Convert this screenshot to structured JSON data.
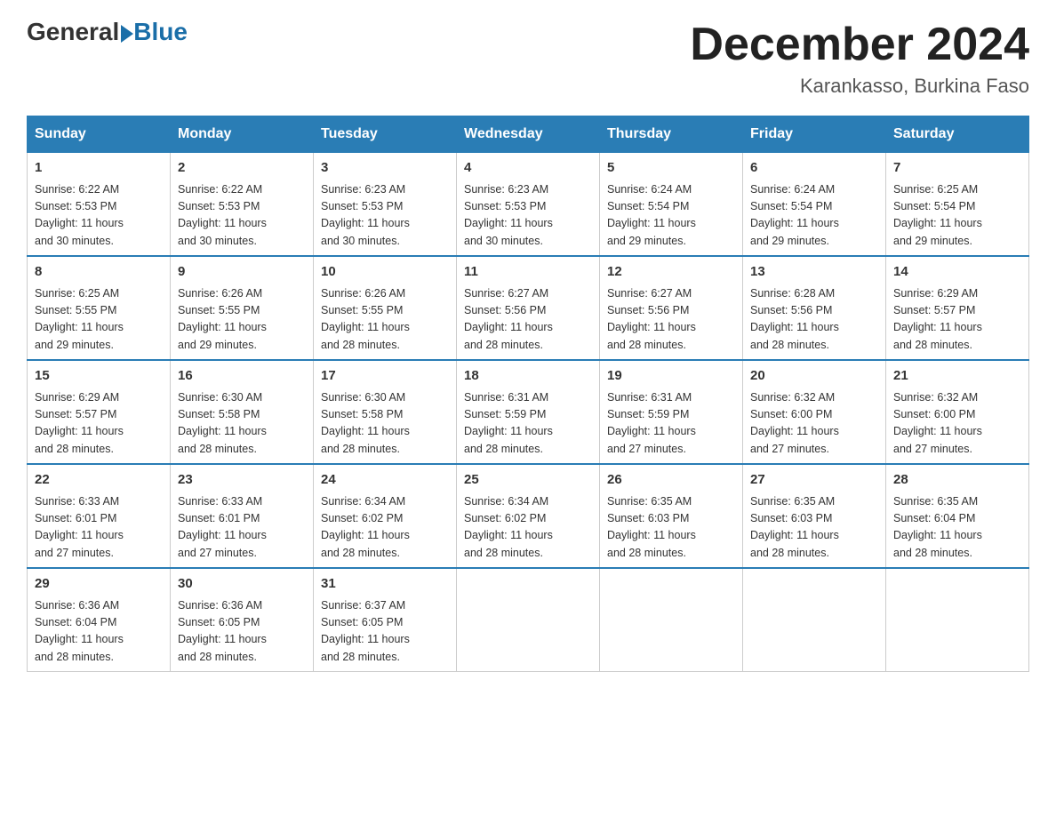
{
  "logo": {
    "general": "General",
    "blue": "Blue"
  },
  "header": {
    "month": "December 2024",
    "location": "Karankasso, Burkina Faso"
  },
  "weekdays": [
    "Sunday",
    "Monday",
    "Tuesday",
    "Wednesday",
    "Thursday",
    "Friday",
    "Saturday"
  ],
  "weeks": [
    [
      {
        "day": "1",
        "sunrise": "6:22 AM",
        "sunset": "5:53 PM",
        "daylight": "11 hours and 30 minutes."
      },
      {
        "day": "2",
        "sunrise": "6:22 AM",
        "sunset": "5:53 PM",
        "daylight": "11 hours and 30 minutes."
      },
      {
        "day": "3",
        "sunrise": "6:23 AM",
        "sunset": "5:53 PM",
        "daylight": "11 hours and 30 minutes."
      },
      {
        "day": "4",
        "sunrise": "6:23 AM",
        "sunset": "5:53 PM",
        "daylight": "11 hours and 30 minutes."
      },
      {
        "day": "5",
        "sunrise": "6:24 AM",
        "sunset": "5:54 PM",
        "daylight": "11 hours and 29 minutes."
      },
      {
        "day": "6",
        "sunrise": "6:24 AM",
        "sunset": "5:54 PM",
        "daylight": "11 hours and 29 minutes."
      },
      {
        "day": "7",
        "sunrise": "6:25 AM",
        "sunset": "5:54 PM",
        "daylight": "11 hours and 29 minutes."
      }
    ],
    [
      {
        "day": "8",
        "sunrise": "6:25 AM",
        "sunset": "5:55 PM",
        "daylight": "11 hours and 29 minutes."
      },
      {
        "day": "9",
        "sunrise": "6:26 AM",
        "sunset": "5:55 PM",
        "daylight": "11 hours and 29 minutes."
      },
      {
        "day": "10",
        "sunrise": "6:26 AM",
        "sunset": "5:55 PM",
        "daylight": "11 hours and 28 minutes."
      },
      {
        "day": "11",
        "sunrise": "6:27 AM",
        "sunset": "5:56 PM",
        "daylight": "11 hours and 28 minutes."
      },
      {
        "day": "12",
        "sunrise": "6:27 AM",
        "sunset": "5:56 PM",
        "daylight": "11 hours and 28 minutes."
      },
      {
        "day": "13",
        "sunrise": "6:28 AM",
        "sunset": "5:56 PM",
        "daylight": "11 hours and 28 minutes."
      },
      {
        "day": "14",
        "sunrise": "6:29 AM",
        "sunset": "5:57 PM",
        "daylight": "11 hours and 28 minutes."
      }
    ],
    [
      {
        "day": "15",
        "sunrise": "6:29 AM",
        "sunset": "5:57 PM",
        "daylight": "11 hours and 28 minutes."
      },
      {
        "day": "16",
        "sunrise": "6:30 AM",
        "sunset": "5:58 PM",
        "daylight": "11 hours and 28 minutes."
      },
      {
        "day": "17",
        "sunrise": "6:30 AM",
        "sunset": "5:58 PM",
        "daylight": "11 hours and 28 minutes."
      },
      {
        "day": "18",
        "sunrise": "6:31 AM",
        "sunset": "5:59 PM",
        "daylight": "11 hours and 28 minutes."
      },
      {
        "day": "19",
        "sunrise": "6:31 AM",
        "sunset": "5:59 PM",
        "daylight": "11 hours and 27 minutes."
      },
      {
        "day": "20",
        "sunrise": "6:32 AM",
        "sunset": "6:00 PM",
        "daylight": "11 hours and 27 minutes."
      },
      {
        "day": "21",
        "sunrise": "6:32 AM",
        "sunset": "6:00 PM",
        "daylight": "11 hours and 27 minutes."
      }
    ],
    [
      {
        "day": "22",
        "sunrise": "6:33 AM",
        "sunset": "6:01 PM",
        "daylight": "11 hours and 27 minutes."
      },
      {
        "day": "23",
        "sunrise": "6:33 AM",
        "sunset": "6:01 PM",
        "daylight": "11 hours and 27 minutes."
      },
      {
        "day": "24",
        "sunrise": "6:34 AM",
        "sunset": "6:02 PM",
        "daylight": "11 hours and 28 minutes."
      },
      {
        "day": "25",
        "sunrise": "6:34 AM",
        "sunset": "6:02 PM",
        "daylight": "11 hours and 28 minutes."
      },
      {
        "day": "26",
        "sunrise": "6:35 AM",
        "sunset": "6:03 PM",
        "daylight": "11 hours and 28 minutes."
      },
      {
        "day": "27",
        "sunrise": "6:35 AM",
        "sunset": "6:03 PM",
        "daylight": "11 hours and 28 minutes."
      },
      {
        "day": "28",
        "sunrise": "6:35 AM",
        "sunset": "6:04 PM",
        "daylight": "11 hours and 28 minutes."
      }
    ],
    [
      {
        "day": "29",
        "sunrise": "6:36 AM",
        "sunset": "6:04 PM",
        "daylight": "11 hours and 28 minutes."
      },
      {
        "day": "30",
        "sunrise": "6:36 AM",
        "sunset": "6:05 PM",
        "daylight": "11 hours and 28 minutes."
      },
      {
        "day": "31",
        "sunrise": "6:37 AM",
        "sunset": "6:05 PM",
        "daylight": "11 hours and 28 minutes."
      },
      null,
      null,
      null,
      null
    ]
  ],
  "labels": {
    "sunrise": "Sunrise:",
    "sunset": "Sunset:",
    "daylight": "Daylight:"
  }
}
